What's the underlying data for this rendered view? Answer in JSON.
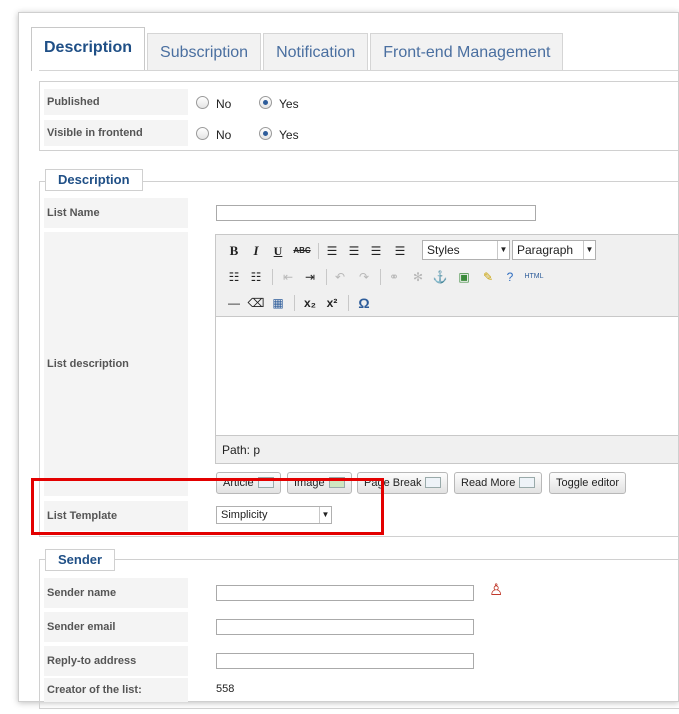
{
  "tabs": [
    "Description",
    "Subscription",
    "Notification",
    "Front-end Management"
  ],
  "published": {
    "label": "Published",
    "no": "No",
    "yes": "Yes",
    "selected": "Yes"
  },
  "visible": {
    "label": "Visible in frontend",
    "no": "No",
    "yes": "Yes",
    "selected": "Yes"
  },
  "description_section": {
    "legend": "Description",
    "list_name_label": "List Name",
    "list_name_value": "",
    "list_desc_label": "List description",
    "toolbar": {
      "bold": "B",
      "italic": "I",
      "underline": "U",
      "strike": "ABC",
      "styles": "Styles",
      "paragraph": "Paragraph",
      "html": "HTML",
      "subscript": "x₂",
      "superscript": "x²",
      "omega": "Ω"
    },
    "path": "Path: p",
    "buttons": [
      "Article",
      "Image",
      "Page Break",
      "Read More",
      "Toggle editor"
    ],
    "template_label": "List Template",
    "template_value": "Simplicity"
  },
  "sender_section": {
    "legend": "Sender",
    "sender_name_label": "Sender name",
    "sender_email_label": "Sender email",
    "reply_label": "Reply-to address",
    "creator_label": "Creator of the list:",
    "creator_value": "558"
  },
  "colors": {
    "accent": "#1f4f86",
    "highlight": "#e30000"
  }
}
